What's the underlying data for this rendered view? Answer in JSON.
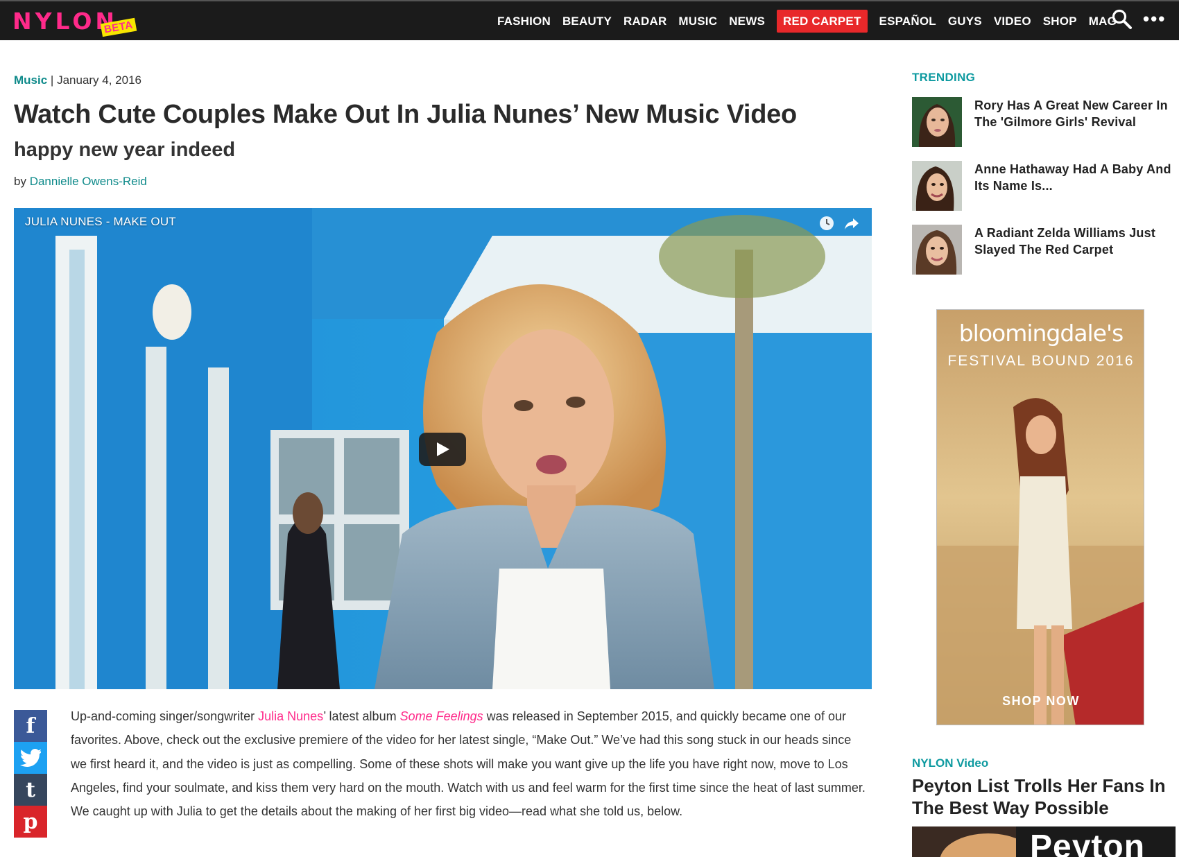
{
  "brand": {
    "logo": "NYLON",
    "badge": "BETA"
  },
  "nav": {
    "items": [
      "FASHION",
      "BEAUTY",
      "RADAR",
      "MUSIC",
      "NEWS",
      "RED CARPET",
      "ESPAÑOL",
      "GUYS",
      "VIDEO",
      "SHOP",
      "MAG"
    ],
    "highlighted": "RED CARPET",
    "search_icon": "search-icon",
    "more_icon": "more-dots-icon",
    "more_label": "•••"
  },
  "article": {
    "category": "Music",
    "separator": "|",
    "date": "January 4, 2016",
    "headline": "Watch Cute Couples Make Out In Julia Nunes’ New Music Video",
    "dek": "happy new year indeed",
    "by": "by",
    "author": "Dannielle Owens-Reid",
    "video": {
      "title": "JULIA NUNES - MAKE OUT",
      "icons": [
        "watch-later-icon",
        "share-icon",
        "play-icon"
      ]
    },
    "share": {
      "facebook": "f",
      "twitter": "twitter-bird-icon",
      "tumblr": "t",
      "pinterest": "p"
    },
    "body": {
      "p1_pre": "Up-and-coming singer/songwriter ",
      "p1_link": "Julia Nunes",
      "p1_mid": "’ latest album ",
      "p1_album": "Some Feelings",
      "p1_rest": " was released in September 2015, and quickly became one of our favorites. Above, check out the exclusive premiere of the video for her latest single, “Make Out.” We’ve had this song stuck in our heads since we first heard it, and the video is just as compelling. Some of these shots will make you want give up the life you have right now, move to Los Angeles, find your soulmate, and kiss them very hard on the mouth. Watch with us and feel warm for the first time since the heat of last summer. We caught up with Julia to get the details about the making of her first big video—read what she told us, below."
    }
  },
  "sidebar": {
    "trending_heading": "TRENDING",
    "trending": [
      {
        "title": "Rory Has A Great New Career In The 'Gilmore Girls' Revival"
      },
      {
        "title": "Anne Hathaway Had A Baby And Its Name Is..."
      },
      {
        "title": "A Radiant Zelda Williams Just Slayed The Red Carpet"
      }
    ],
    "ad": {
      "brand": "bloomingdale's",
      "tagline": "FESTIVAL BOUND 2016",
      "cta": "SHOP NOW"
    },
    "video_label": "NYLON Video",
    "video_title": "Peyton List Trolls Her Fans In The Best Way Possible",
    "video_thumb_text": "Peyton"
  },
  "colors": {
    "brand_pink": "#ff2a8a",
    "teal": "#0e9aa0",
    "nav_bg": "#1b1b1b",
    "red_carpet": "#e8282a"
  }
}
